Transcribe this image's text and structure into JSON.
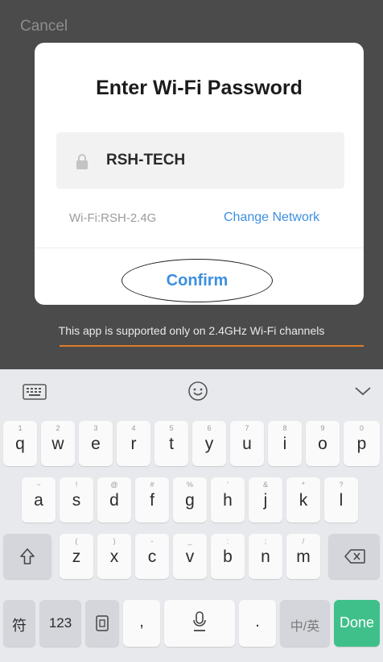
{
  "top": {
    "cancel_label": "Cancel"
  },
  "dialog": {
    "title": "Enter Wi-Fi Password",
    "password_value": "RSH-TECH",
    "wifi_label": "Wi-Fi:RSH-2.4G",
    "change_network_label": "Change Network",
    "confirm_label": "Confirm"
  },
  "notice": "This app is supported only on 2.4GHz Wi-Fi channels",
  "colors": {
    "accent": "#3c8fe0",
    "done": "#3fc08a",
    "underline": "#e07c27"
  },
  "keyboard": {
    "toolbar_icons": [
      "keyboard-icon",
      "emoji-icon",
      "chevron-down-icon"
    ],
    "row1": [
      {
        "main": "q",
        "sub": "1"
      },
      {
        "main": "w",
        "sub": "2"
      },
      {
        "main": "e",
        "sub": "3"
      },
      {
        "main": "r",
        "sub": "4"
      },
      {
        "main": "t",
        "sub": "5"
      },
      {
        "main": "y",
        "sub": "6"
      },
      {
        "main": "u",
        "sub": "7"
      },
      {
        "main": "i",
        "sub": "8"
      },
      {
        "main": "o",
        "sub": "9"
      },
      {
        "main": "p",
        "sub": "0"
      }
    ],
    "row2": [
      {
        "main": "a",
        "sub": "~"
      },
      {
        "main": "s",
        "sub": "!"
      },
      {
        "main": "d",
        "sub": "@"
      },
      {
        "main": "f",
        "sub": "#"
      },
      {
        "main": "g",
        "sub": "%"
      },
      {
        "main": "h",
        "sub": "'"
      },
      {
        "main": "j",
        "sub": "&"
      },
      {
        "main": "k",
        "sub": "*"
      },
      {
        "main": "l",
        "sub": "?"
      }
    ],
    "row3": [
      {
        "main": "z",
        "sub": "("
      },
      {
        "main": "x",
        "sub": ")"
      },
      {
        "main": "c",
        "sub": "-"
      },
      {
        "main": "v",
        "sub": "_"
      },
      {
        "main": "b",
        "sub": ":"
      },
      {
        "main": "n",
        "sub": ";"
      },
      {
        "main": "m",
        "sub": "/"
      }
    ],
    "row4": {
      "symbol": "符",
      "numbers": "123",
      "comma": ",",
      "period": ".",
      "lang": "中/英",
      "done": "Done"
    }
  }
}
